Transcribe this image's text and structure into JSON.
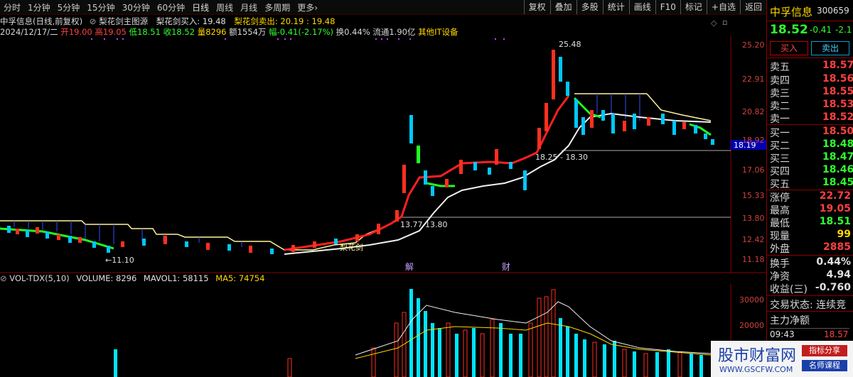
{
  "toolbar": {
    "tabs": [
      "分时",
      "1分钟",
      "5分钟",
      "15分钟",
      "30分钟",
      "60分钟",
      "日线",
      "周线",
      "月线",
      "多周期",
      "更多›"
    ],
    "right": [
      "复权",
      "叠加",
      "多股",
      "统计",
      "画线",
      "F10",
      "标记",
      "+自选",
      "返回"
    ]
  },
  "header": {
    "line1_title": "中孚信息(日线,前复权)",
    "line1_indicator": "梨花剑主图源",
    "line1_buy": "梨花剑买入: 19.48",
    "line1_sell": "梨花剑卖出: 20.19 : 19.48",
    "line2_date": "2024/12/17/二",
    "line2_open": "开19.00",
    "line2_high": "高19.05",
    "line2_low": "低18.51",
    "line2_close": "收18.52",
    "line2_vol": "量8296",
    "line2_amt": "额1554万",
    "line2_chg": "幅-0.41(-2.17%)",
    "line2_turn": "换0.44%",
    "line2_float": "流通1.90亿",
    "line2_sector": "其他IT设备"
  },
  "price_axis": [
    "25.20",
    "22.91",
    "20.82",
    "18.92",
    "17.06",
    "15.33",
    "13.80",
    "12.42",
    "11.18"
  ],
  "price_tag": "18.19",
  "annotations": {
    "high": "25.48",
    "low": "←11.10",
    "range1a": "13.77",
    "range1b": "13.80",
    "range2": "18.25 - 18.30",
    "lihuajian": "梨花剑",
    "jie": "解",
    "cai": "财"
  },
  "volume_header": {
    "name": "VOL-TDX(5,10)",
    "volume": "VOLUME: 8296",
    "mavol1": "MAVOL1: 58115",
    "ma5": "MA5: 74754"
  },
  "volume_axis": [
    "30000",
    "20000"
  ],
  "sidebar": {
    "stock_name": "中孚信息",
    "stock_code": "300659",
    "price": "18.52",
    "change": "-0.41",
    "change_pct": "-2.1",
    "buy_btn": "买入",
    "sell_btn": "卖出",
    "asks": [
      {
        "label": "卖五",
        "price": "18.57"
      },
      {
        "label": "卖四",
        "price": "18.56"
      },
      {
        "label": "卖三",
        "price": "18.55"
      },
      {
        "label": "卖二",
        "price": "18.53"
      },
      {
        "label": "卖一",
        "price": "18.52"
      }
    ],
    "bids": [
      {
        "label": "买一",
        "price": "18.50"
      },
      {
        "label": "买二",
        "price": "18.48"
      },
      {
        "label": "买三",
        "price": "18.47"
      },
      {
        "label": "买四",
        "price": "18.46"
      },
      {
        "label": "买五",
        "price": "18.45"
      }
    ],
    "stats": [
      {
        "label": "涨停",
        "value": "22.72"
      },
      {
        "label": "最高",
        "value": "19.05"
      },
      {
        "label": "最低",
        "value": "18.51"
      },
      {
        "label": "现量",
        "value": "99"
      },
      {
        "label": "外盘",
        "value": "2885"
      }
    ],
    "stats2": [
      {
        "label": "换手",
        "value": "0.44%"
      },
      {
        "label": "净资",
        "value": "4.94"
      },
      {
        "label": "收益(三)",
        "value": "-0.760"
      }
    ],
    "trade_status": "交易状态: 连续竞",
    "main_flow": "主力净额",
    "tick_time": "09:43",
    "tick_price": "18.57"
  },
  "watermark": {
    "title": "股市财富网",
    "url": "WWW.GSCFW.COM",
    "tag1": "指标分享",
    "tag2": "名师课程"
  }
}
